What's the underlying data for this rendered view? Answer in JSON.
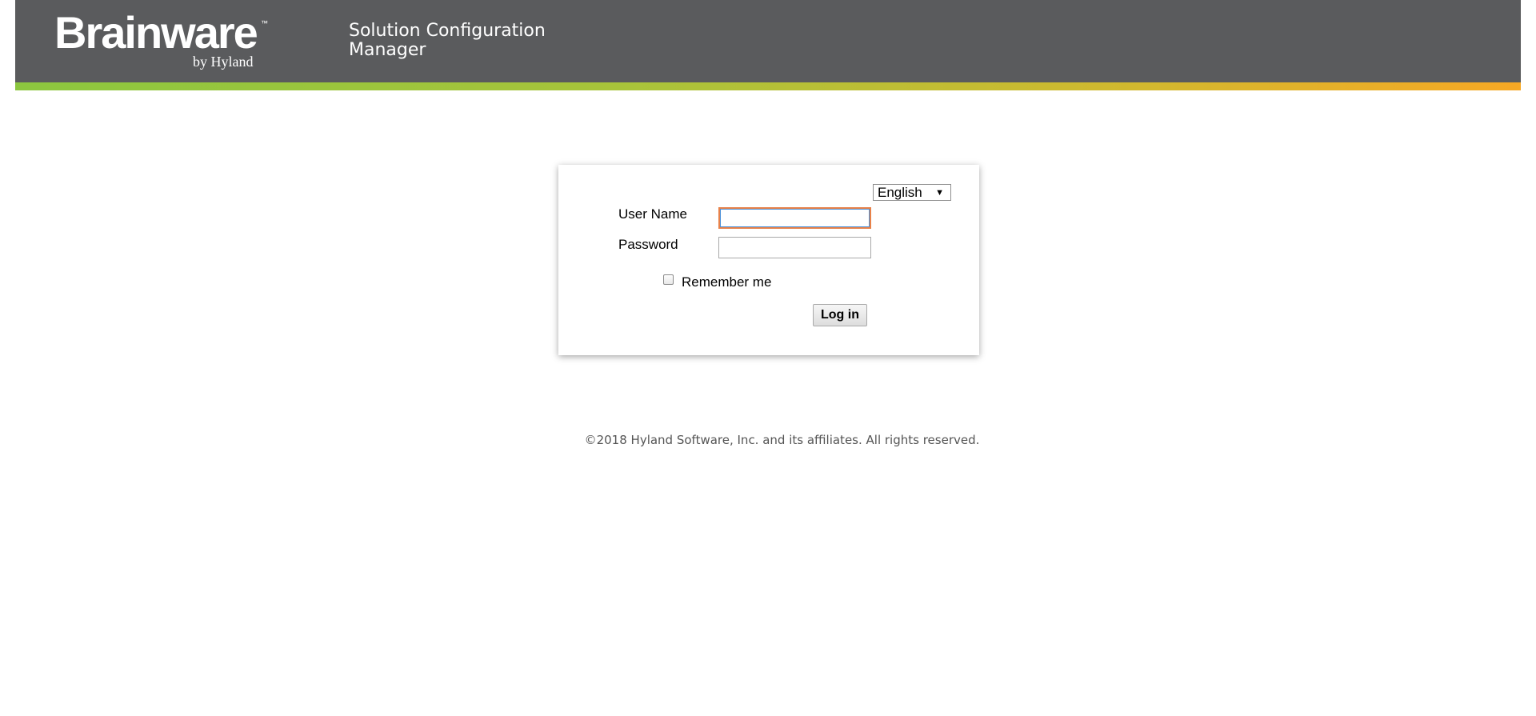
{
  "header": {
    "logo_text": "Brainware",
    "logo_trademark": "™",
    "logo_sub": "by Hyland",
    "app_title": "Solution Configuration Manager"
  },
  "login": {
    "language_selected": "English",
    "username_label": "User Name",
    "username_value": "",
    "password_label": "Password",
    "password_value": "",
    "remember_label": "Remember me",
    "remember_checked": false,
    "login_button": "Log in"
  },
  "footer": {
    "copyright": "©2018 Hyland Software, Inc. and its affiliates. All rights reserved."
  },
  "colors": {
    "header_bg": "#5a5b5d",
    "accent_start": "#8cc63f",
    "accent_end": "#f7a824",
    "focus_border": "#e8824a"
  }
}
